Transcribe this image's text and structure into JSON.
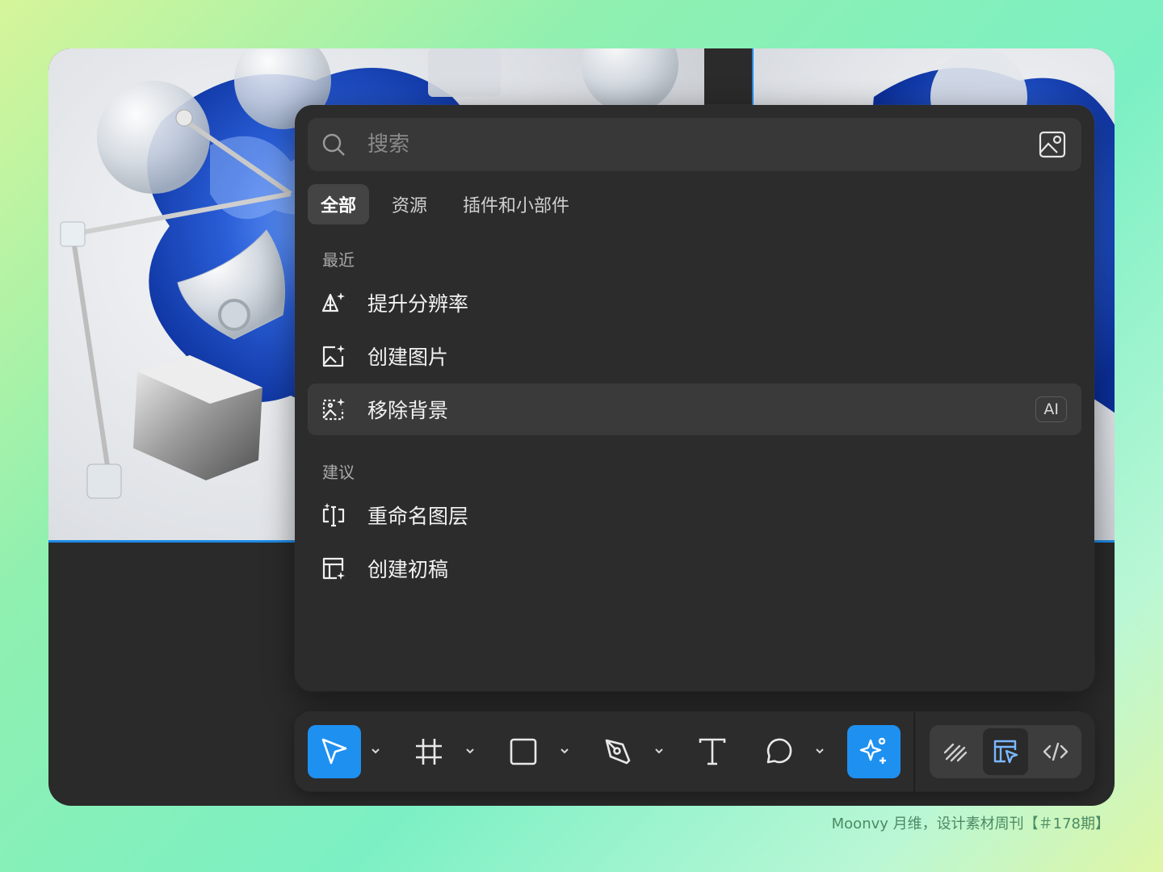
{
  "search": {
    "placeholder": "搜索",
    "value": ""
  },
  "tabs": [
    {
      "label": "全部",
      "active": true
    },
    {
      "label": "资源",
      "active": false
    },
    {
      "label": "插件和小部件",
      "active": false
    }
  ],
  "sections": {
    "recent": {
      "label": "最近",
      "items": [
        {
          "label": "提升分辨率",
          "icon": "upscale-icon"
        },
        {
          "label": "创建图片",
          "icon": "create-image-icon"
        },
        {
          "label": "移除背景",
          "icon": "remove-background-icon",
          "badge": "AI"
        }
      ]
    },
    "suggested": {
      "label": "建议",
      "items": [
        {
          "label": "重命名图层",
          "icon": "rename-layers-icon"
        },
        {
          "label": "创建初稿",
          "icon": "first-draft-icon"
        }
      ]
    }
  },
  "toolbar": {
    "tools": [
      {
        "name": "move",
        "icon": "cursor-icon",
        "active": true
      },
      {
        "name": "frame",
        "icon": "frame-icon",
        "active": false
      },
      {
        "name": "shape",
        "icon": "rectangle-icon",
        "active": false
      },
      {
        "name": "pen",
        "icon": "pen-icon",
        "active": false
      },
      {
        "name": "text",
        "icon": "text-icon",
        "active": false
      },
      {
        "name": "comment",
        "icon": "comment-icon",
        "active": false
      },
      {
        "name": "actions",
        "icon": "ai-sparkle-icon",
        "active": true
      }
    ],
    "modes": [
      {
        "name": "draw",
        "icon": "draw-icon",
        "active": false
      },
      {
        "name": "design",
        "icon": "design-icon",
        "active": true
      },
      {
        "name": "dev",
        "icon": "code-icon",
        "active": false
      }
    ]
  },
  "colors": {
    "accent": "#1e90f0",
    "panel": "#2c2c2c",
    "canvas_selection": "#1e8ae6"
  },
  "caption": "Moonvy 月维，设计素材周刊【＃178期】"
}
